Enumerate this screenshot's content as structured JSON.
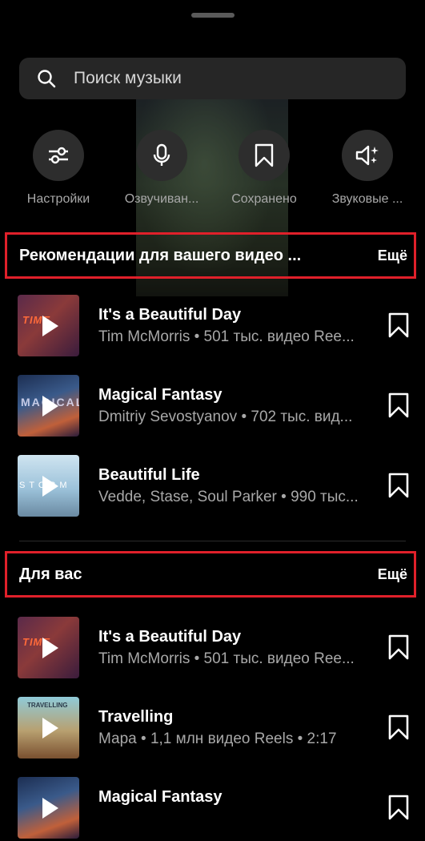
{
  "search": {
    "placeholder": "Поиск музыки",
    "icon": "search-icon"
  },
  "quick_actions": [
    {
      "label": "Настройки",
      "icon": "sliders-icon"
    },
    {
      "label": "Озвучиван...",
      "icon": "microphone-icon"
    },
    {
      "label": "Сохранено",
      "icon": "bookmark-icon"
    },
    {
      "label": "Звуковые ...",
      "icon": "sound-effects-icon"
    }
  ],
  "recommended": {
    "title": "Рекомендации для вашего видео ...",
    "more": "Ещё",
    "tracks": [
      {
        "title": "It's a Beautiful Day",
        "subtitle": "Tim McMorris • 501 тыс. видео Ree...",
        "thumb_text": "TIME"
      },
      {
        "title": "Magical Fantasy",
        "subtitle": "Dmitriy Sevostyanov • 702 тыс. вид...",
        "thumb_text": "MAGICAL"
      },
      {
        "title": "Beautiful Life",
        "subtitle": "Vedde, Stase, Soul Parker • 990 тыс...",
        "thumb_text": "STORM"
      }
    ]
  },
  "for_you": {
    "title": "Для вас",
    "more": "Ещё",
    "tracks": [
      {
        "title": "It's a Beautiful Day",
        "subtitle": "Tim McMorris • 501 тыс. видео Ree...",
        "thumb_text": "TIME"
      },
      {
        "title": "Travelling",
        "subtitle": "Мара • 1,1 млн видео Reels • 2:17",
        "thumb_text": "TRAVELLING"
      },
      {
        "title": "Magical Fantasy",
        "subtitle": "",
        "thumb_text": ""
      }
    ]
  },
  "colors": {
    "background": "#000000",
    "highlight_border": "#e0202a",
    "secondary_text": "#a8a8a8"
  }
}
